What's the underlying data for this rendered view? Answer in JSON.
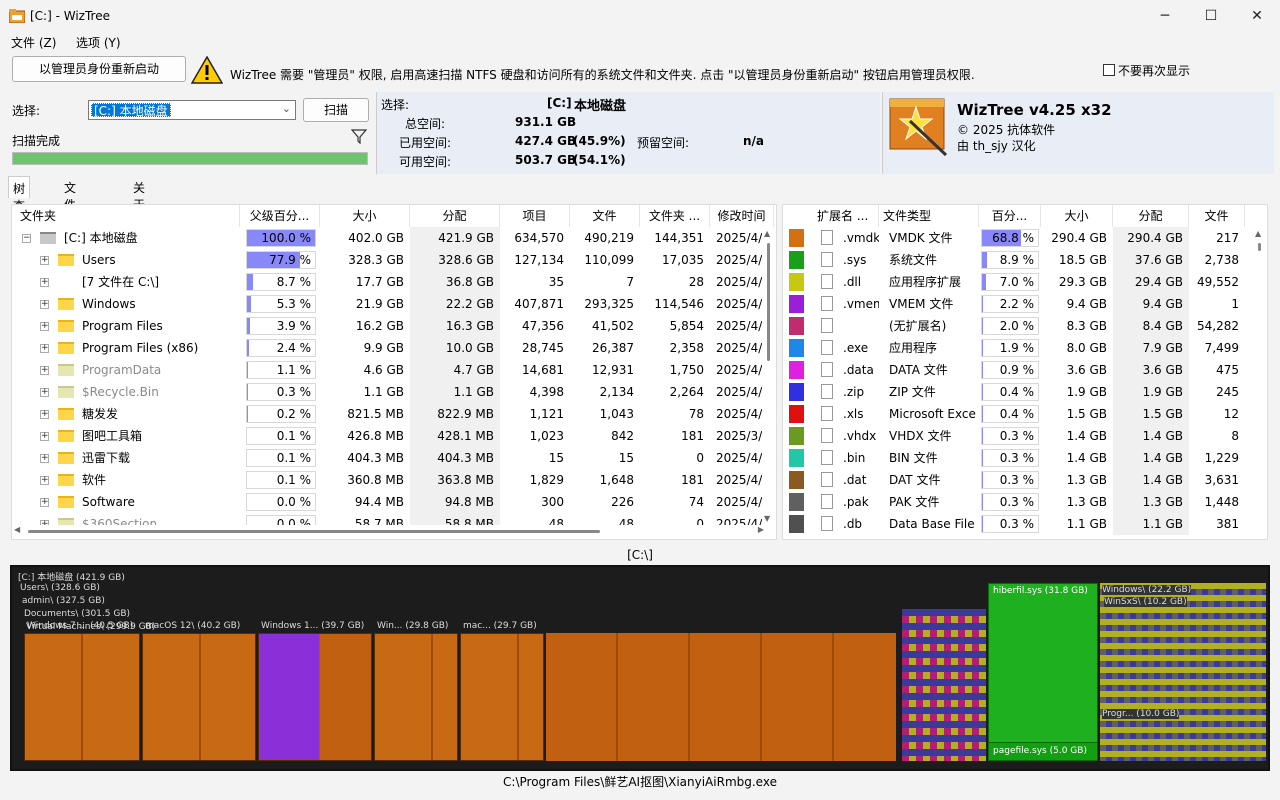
{
  "window": {
    "title": "[C:] - WizTree",
    "icon": "folder-disk-icon",
    "minimize": "─",
    "maximize": "☐",
    "close": "✕"
  },
  "menu": [
    "文件 (Z)",
    "选项 (Y)"
  ],
  "admin": {
    "button": "以管理员身份重新启动",
    "message": "WizTree 需要 \"管理员\" 权限, 启用高速扫描 NTFS 硬盘和访问所有的系统文件和文件夹. 点击 \"以管理员身份重新启动\" 按钮启用管理员权限.",
    "dont_show": "不要再次显示"
  },
  "select": {
    "label": "选择:",
    "drive": "[C:] 本地磁盘",
    "scan": "扫描",
    "status": "扫描完成",
    "progress": 1.0
  },
  "info": {
    "label": "选择:",
    "drive": "[C:]",
    "drive_name": "本地磁盘",
    "total_label": "总空间:",
    "total": "931.1 GB",
    "used_label": "已用空间:",
    "used": "427.4 GB",
    "used_pct": "(45.9%)",
    "reserved_label": "预留空间:",
    "reserved": "n/a",
    "free_label": "可用空间:",
    "free": "503.7 GB",
    "free_pct": "(54.1%)"
  },
  "about": {
    "name": "WizTree v4.25 x32",
    "copyright": "© 2025 抗体软件",
    "translator": "由 th_sjy 汉化"
  },
  "tabs": [
    "树查看",
    "文件查看",
    "关于"
  ],
  "tree": {
    "headers": [
      "文件夹",
      "父级百分...",
      "大小",
      "分配",
      "项目",
      "文件",
      "文件夹 ...",
      "修改时间"
    ],
    "rows": [
      {
        "name": "[C:] 本地磁盘",
        "pct": "100.0 %",
        "fill": 1.0,
        "size": "402.0 GB",
        "alloc": "421.9 GB",
        "items": "634,570",
        "files": "490,219",
        "folders": "144,351",
        "mod": "2025/4/",
        "icon": "drive-icon",
        "indent": 0,
        "gray": false
      },
      {
        "name": "Users",
        "pct": "77.9 %",
        "fill": 0.779,
        "size": "328.3 GB",
        "alloc": "328.6 GB",
        "items": "127,134",
        "files": "110,099",
        "folders": "17,035",
        "mod": "2025/4/",
        "icon": "folder-icon",
        "indent": 1,
        "gray": false
      },
      {
        "name": "[7 文件在     C:\\]",
        "pct": "8.7 %",
        "fill": 0.087,
        "size": "17.7 GB",
        "alloc": "36.8 GB",
        "items": "35",
        "files": "7",
        "folders": "28",
        "mod": "2025/4/",
        "icon": "",
        "indent": 1,
        "gray": false
      },
      {
        "name": "Windows",
        "pct": "5.3 %",
        "fill": 0.053,
        "size": "21.9 GB",
        "alloc": "22.2 GB",
        "items": "407,871",
        "files": "293,325",
        "folders": "114,546",
        "mod": "2025/4/",
        "icon": "folder-icon",
        "indent": 1,
        "gray": false
      },
      {
        "name": "Program Files",
        "pct": "3.9 %",
        "fill": 0.039,
        "size": "16.2 GB",
        "alloc": "16.3 GB",
        "items": "47,356",
        "files": "41,502",
        "folders": "5,854",
        "mod": "2025/4/",
        "icon": "folder-icon",
        "indent": 1,
        "gray": false
      },
      {
        "name": "Program Files (x86)",
        "pct": "2.4 %",
        "fill": 0.024,
        "size": "9.9 GB",
        "alloc": "10.0 GB",
        "items": "28,745",
        "files": "26,387",
        "folders": "2,358",
        "mod": "2025/4/",
        "icon": "folder-icon",
        "indent": 1,
        "gray": false
      },
      {
        "name": "ProgramData",
        "pct": "1.1 %",
        "fill": 0.011,
        "size": "4.6 GB",
        "alloc": "4.7 GB",
        "items": "14,681",
        "files": "12,931",
        "folders": "1,750",
        "mod": "2025/4/",
        "icon": "folder-icon",
        "indent": 1,
        "gray": true
      },
      {
        "name": "$Recycle.Bin",
        "pct": "0.3 %",
        "fill": 0.003,
        "size": "1.1 GB",
        "alloc": "1.1 GB",
        "items": "4,398",
        "files": "2,134",
        "folders": "2,264",
        "mod": "2025/4/",
        "icon": "recycle-icon",
        "indent": 1,
        "gray": true
      },
      {
        "name": "糖发发",
        "pct": "0.2 %",
        "fill": 0.002,
        "size": "821.5 MB",
        "alloc": "822.9 MB",
        "items": "1,121",
        "files": "1,043",
        "folders": "78",
        "mod": "2025/4/",
        "icon": "folder-icon",
        "indent": 1,
        "gray": false
      },
      {
        "name": "图吧工具箱",
        "pct": "0.1 %",
        "fill": 0.001,
        "size": "426.8 MB",
        "alloc": "428.1 MB",
        "items": "1,023",
        "files": "842",
        "folders": "181",
        "mod": "2025/3/",
        "icon": "folder-icon",
        "indent": 1,
        "gray": false
      },
      {
        "name": "迅雷下载",
        "pct": "0.1 %",
        "fill": 0.001,
        "size": "404.3 MB",
        "alloc": "404.3 MB",
        "items": "15",
        "files": "15",
        "folders": "0",
        "mod": "2025/4/",
        "icon": "folder-icon",
        "indent": 1,
        "gray": false
      },
      {
        "name": "软件",
        "pct": "0.1 %",
        "fill": 0.001,
        "size": "360.8 MB",
        "alloc": "363.8 MB",
        "items": "1,829",
        "files": "1,648",
        "folders": "181",
        "mod": "2025/4/",
        "icon": "folder-icon",
        "indent": 1,
        "gray": false
      },
      {
        "name": "Software",
        "pct": "0.0 %",
        "fill": 0.0,
        "size": "94.4 MB",
        "alloc": "94.8 MB",
        "items": "300",
        "files": "226",
        "folders": "74",
        "mod": "2025/4/",
        "icon": "folder-icon",
        "indent": 1,
        "gray": false
      },
      {
        "name": "$360Section",
        "pct": "0.0 %",
        "fill": 0.0,
        "size": "58.7 MB",
        "alloc": "58.8 MB",
        "items": "48",
        "files": "48",
        "folders": "0",
        "mod": "2025/4/",
        "icon": "folder-icon",
        "indent": 1,
        "gray": true
      }
    ]
  },
  "ext": {
    "headers": [
      "扩展名 ...",
      "文件类型",
      "百分...",
      "大小",
      "分配",
      "文件"
    ],
    "rows": [
      {
        "color": "#d4700f",
        "ext": ".vmdk",
        "type": "VMDK 文件",
        "pct": "68.8 %",
        "fill": 0.688,
        "size": "290.4 GB",
        "alloc": "290.4 GB",
        "files": "217"
      },
      {
        "color": "#18a018",
        "ext": ".sys",
        "type": "系统文件",
        "pct": "8.9 %",
        "fill": 0.089,
        "size": "18.5 GB",
        "alloc": "37.6 GB",
        "files": "2,738"
      },
      {
        "color": "#c8c810",
        "ext": ".dll",
        "type": "应用程序扩展",
        "pct": "7.0 %",
        "fill": 0.07,
        "size": "29.3 GB",
        "alloc": "29.4 GB",
        "files": "49,552"
      },
      {
        "color": "#9a20d8",
        "ext": ".vmem",
        "type": "VMEM 文件",
        "pct": "2.2 %",
        "fill": 0.022,
        "size": "9.4 GB",
        "alloc": "9.4 GB",
        "files": "1"
      },
      {
        "color": "#c02c70",
        "ext": "",
        "type": "(无扩展名)",
        "pct": "2.0 %",
        "fill": 0.02,
        "size": "8.3 GB",
        "alloc": "8.4 GB",
        "files": "54,282"
      },
      {
        "color": "#1e88e8",
        "ext": ".exe",
        "type": "应用程序",
        "pct": "1.9 %",
        "fill": 0.019,
        "size": "8.0 GB",
        "alloc": "7.9 GB",
        "files": "7,499"
      },
      {
        "color": "#e020e0",
        "ext": ".data",
        "type": "DATA 文件",
        "pct": "0.9 %",
        "fill": 0.009,
        "size": "3.6 GB",
        "alloc": "3.6 GB",
        "files": "475"
      },
      {
        "color": "#3030e0",
        "ext": ".zip",
        "type": "ZIP 文件",
        "pct": "0.4 %",
        "fill": 0.004,
        "size": "1.9 GB",
        "alloc": "1.9 GB",
        "files": "245"
      },
      {
        "color": "#e01010",
        "ext": ".xls",
        "type": "Microsoft Excel 9",
        "pct": "0.4 %",
        "fill": 0.004,
        "size": "1.5 GB",
        "alloc": "1.5 GB",
        "files": "12"
      },
      {
        "color": "#6a9a20",
        "ext": ".vhdx",
        "type": "VHDX 文件",
        "pct": "0.3 %",
        "fill": 0.003,
        "size": "1.4 GB",
        "alloc": "1.4 GB",
        "files": "8"
      },
      {
        "color": "#20c8a8",
        "ext": ".bin",
        "type": "BIN 文件",
        "pct": "0.3 %",
        "fill": 0.003,
        "size": "1.4 GB",
        "alloc": "1.4 GB",
        "files": "1,229"
      },
      {
        "color": "#8a5a20",
        "ext": ".dat",
        "type": "DAT 文件",
        "pct": "0.3 %",
        "fill": 0.003,
        "size": "1.3 GB",
        "alloc": "1.4 GB",
        "files": "3,631"
      },
      {
        "color": "#606060",
        "ext": ".pak",
        "type": "PAK 文件",
        "pct": "0.3 %",
        "fill": 0.003,
        "size": "1.3 GB",
        "alloc": "1.3 GB",
        "files": "1,448"
      },
      {
        "color": "#505050",
        "ext": ".db",
        "type": "Data Base File",
        "pct": "0.3 %",
        "fill": 0.003,
        "size": "1.1 GB",
        "alloc": "1.1 GB",
        "files": "381"
      }
    ]
  },
  "treemap": {
    "path": "[C:\\]",
    "labels": [
      "[C:] 本地磁盘  (421.9 GB)",
      "Users\\  (328.6 GB)",
      "admin\\  (327.5 GB)",
      "Documents\\  (301.5 GB)",
      "Virtual Machines\\  (299.9 GB)"
    ],
    "vms": [
      "Windows 7 ...  (40.5 GB)",
      "macOS 12\\  (40.2 GB)",
      "Windows 1...  (39.7 GB)",
      "Win...  (29.8 GB)",
      "mac...  (29.7 GB)"
    ],
    "hiberfil": "hiberfil.sys  (31.8 GB)",
    "pagefile": "pagefile.sys  (5.0 GB)",
    "windows": "Windows\\  (22.2 GB)",
    "winsxs": "WinSxS\\  (10.2 GB)",
    "progr": "Progr...  (10.0 GB)"
  },
  "status": "C:\\Program Files\\鲜艺AI抠图\\XianyiAiRmbg.exe"
}
